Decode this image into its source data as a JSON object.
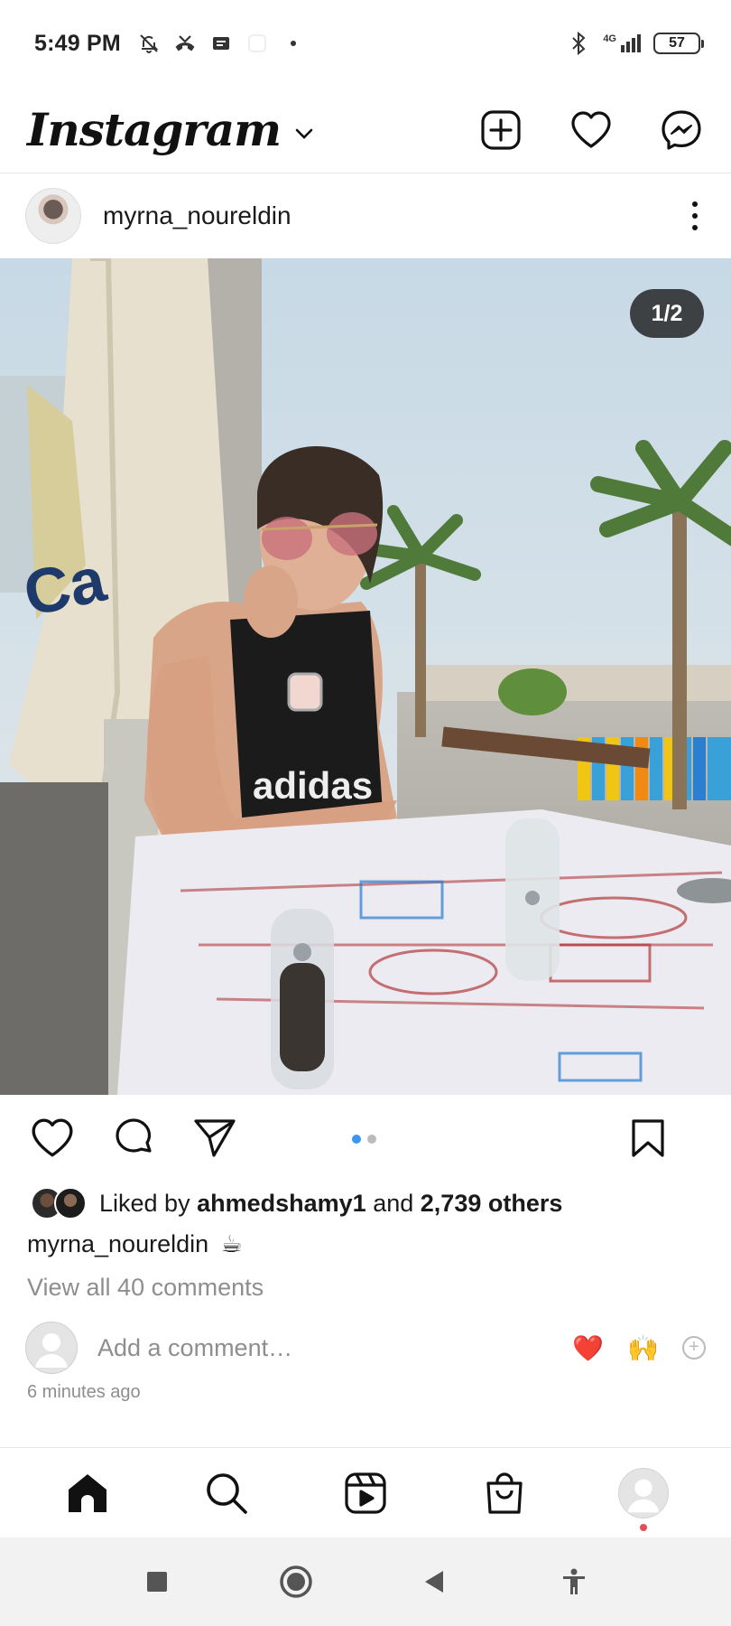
{
  "status_bar": {
    "time": "5:49 PM",
    "network": "4G",
    "battery": "57"
  },
  "header": {
    "logo_text": "Instagram",
    "icons": [
      "new-post-icon",
      "heart-icon",
      "messenger-icon"
    ]
  },
  "post": {
    "username": "myrna_noureldin",
    "image_counter": "1/2",
    "likes_prefix": "Liked by",
    "liked_by_user": "ahmedshamy1",
    "likes_and": "and",
    "likes_others": "2,739 others",
    "caption_user": "myrna_noureldin",
    "caption_text": "☕",
    "view_comments": "View all 40 comments",
    "comment_placeholder": "Add a comment…",
    "quick_reacts": [
      "❤️",
      "🙌"
    ],
    "time_ago": "6 minutes ago",
    "carousel_index": 1,
    "carousel_total": 2
  },
  "bottom_nav": {
    "items": [
      "home-icon",
      "search-icon",
      "reels-icon",
      "shop-icon",
      "profile"
    ]
  },
  "colors": {
    "accent_blue": "#3897f0",
    "notification_red": "#ed4956",
    "secondary_text": "#8e8e8e"
  }
}
